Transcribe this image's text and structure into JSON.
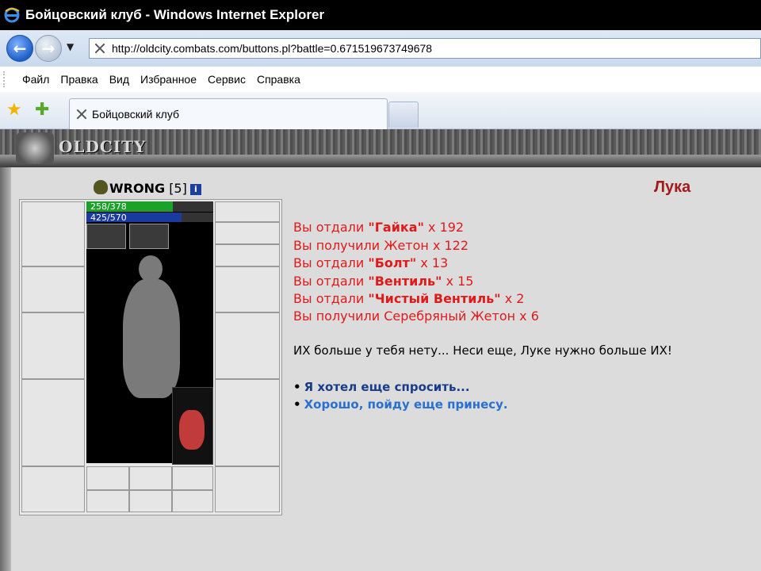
{
  "window": {
    "title": "Бойцовский клуб - Windows Internet Explorer"
  },
  "address": {
    "url": "http://oldcity.combats.com/buttons.pl?battle=0.671519673749678"
  },
  "menu": {
    "items": [
      "Файл",
      "Правка",
      "Вид",
      "Избранное",
      "Сервис",
      "Справка"
    ]
  },
  "tab": {
    "title": "Бойцовский клуб"
  },
  "game": {
    "logo": "OLDCITY"
  },
  "character": {
    "name": "WRONG",
    "level": "[5]",
    "hp": "258/378",
    "mana": "425/570",
    "hp_fraction": 0.68,
    "mana_fraction": 0.75
  },
  "npc": {
    "name": "Лука"
  },
  "trades": [
    {
      "prefix": "Вы отдали ",
      "item": "\"Гайка\"",
      "suffix": " x 192"
    },
    {
      "prefix": "Вы получили Жетон x 122",
      "item": "",
      "suffix": ""
    },
    {
      "prefix": "Вы отдали ",
      "item": "\"Болт\"",
      "suffix": " x 13"
    },
    {
      "prefix": "Вы отдали ",
      "item": "\"Вентиль\"",
      "suffix": " x 15"
    },
    {
      "prefix": "Вы отдали ",
      "item": "\"Чистый Вентиль\"",
      "suffix": " x 2"
    },
    {
      "prefix": "Вы получили Серебряный Жетон x 6",
      "item": "",
      "suffix": ""
    }
  ],
  "message": "ИХ больше у тебя нету... Неси еще, Луке нужно больше ИХ!",
  "options": [
    "Я хотел еще спросить...",
    "Хорошо, пойду еще принесу."
  ],
  "info_icon": "i",
  "colors": {
    "npc": "#a21a1a",
    "trade": "#e01a1a",
    "link1": "#1a3a8a",
    "link2": "#2a70d0"
  }
}
